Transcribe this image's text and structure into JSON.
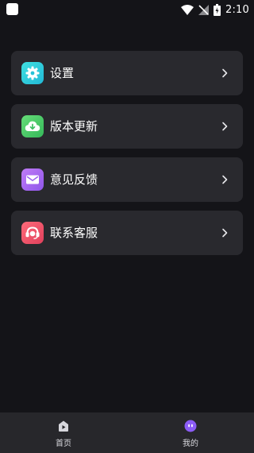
{
  "status_bar": {
    "time": "2:10"
  },
  "menu": {
    "items": [
      {
        "label": "设置",
        "icon": "gear-icon",
        "icon_color": "#2fd0d9"
      },
      {
        "label": "版本更新",
        "icon": "cloud-download-icon",
        "icon_color": "#4fce6b"
      },
      {
        "label": "意见反馈",
        "icon": "mail-icon",
        "icon_color": "#a56cf2"
      },
      {
        "label": "联系客服",
        "icon": "headset-icon",
        "icon_color": "#f0536a"
      }
    ]
  },
  "bottom_nav": {
    "items": [
      {
        "label": "首页",
        "icon": "play-home-icon",
        "active": false
      },
      {
        "label": "我的",
        "icon": "profile-icon",
        "active": true,
        "accent": "#8b5cf6"
      }
    ]
  }
}
